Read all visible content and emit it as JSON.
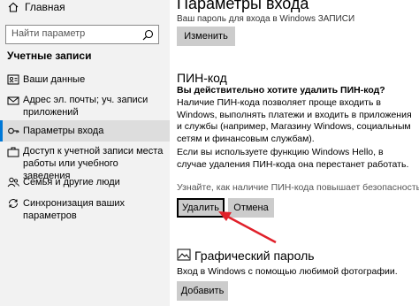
{
  "sidebar": {
    "home_label": "Главная",
    "search_placeholder": "Найти параметр",
    "section_title": "Учетные записи",
    "items": [
      {
        "label": "Ваши данные",
        "icon": "user-card-icon"
      },
      {
        "label": "Адрес эл. почты; уч. записи приложений",
        "icon": "mail-icon"
      },
      {
        "label": "Параметры входа",
        "icon": "key-icon",
        "active": true
      },
      {
        "label": "Доступ к учетной записи места работы или учебного заведения",
        "icon": "briefcase-icon"
      },
      {
        "label": "Семья и другие люди",
        "icon": "people-icon"
      },
      {
        "label": "Синхронизация ваших параметров",
        "icon": "sync-icon"
      }
    ]
  },
  "main": {
    "title": "Параметры входа",
    "top_partial_text": "Ваш пароль для входа в Windows ЗАПИСИ",
    "change_button": "Изменить",
    "pin": {
      "heading": "ПИН-код",
      "question": "Вы действительно хотите удалить ПИН-код?",
      "description": "Наличие ПИН-кода позволяет проще входить в Windows, выполнять платежи и входить в приложения и службы (например, Магазину Windows, социальным сетям и финансовым службам).",
      "hello_note": "Если вы используете функцию Windows Hello, в случае удаления ПИН-кода она перестанет работать.",
      "learn_more": "Узнайте, как наличие ПИН-кода повышает безопасность",
      "delete_button": "Удалить",
      "cancel_button": "Отмена"
    },
    "picture_password": {
      "heading": "Графический пароль",
      "description": "Вход в Windows с помощью любимой фотографии.",
      "add_button": "Добавить"
    }
  },
  "colors": {
    "accent": "#0078d7",
    "arrow": "#e0202a",
    "sidebar_bg": "#f2f2f2",
    "button_bg": "#cccccc"
  }
}
